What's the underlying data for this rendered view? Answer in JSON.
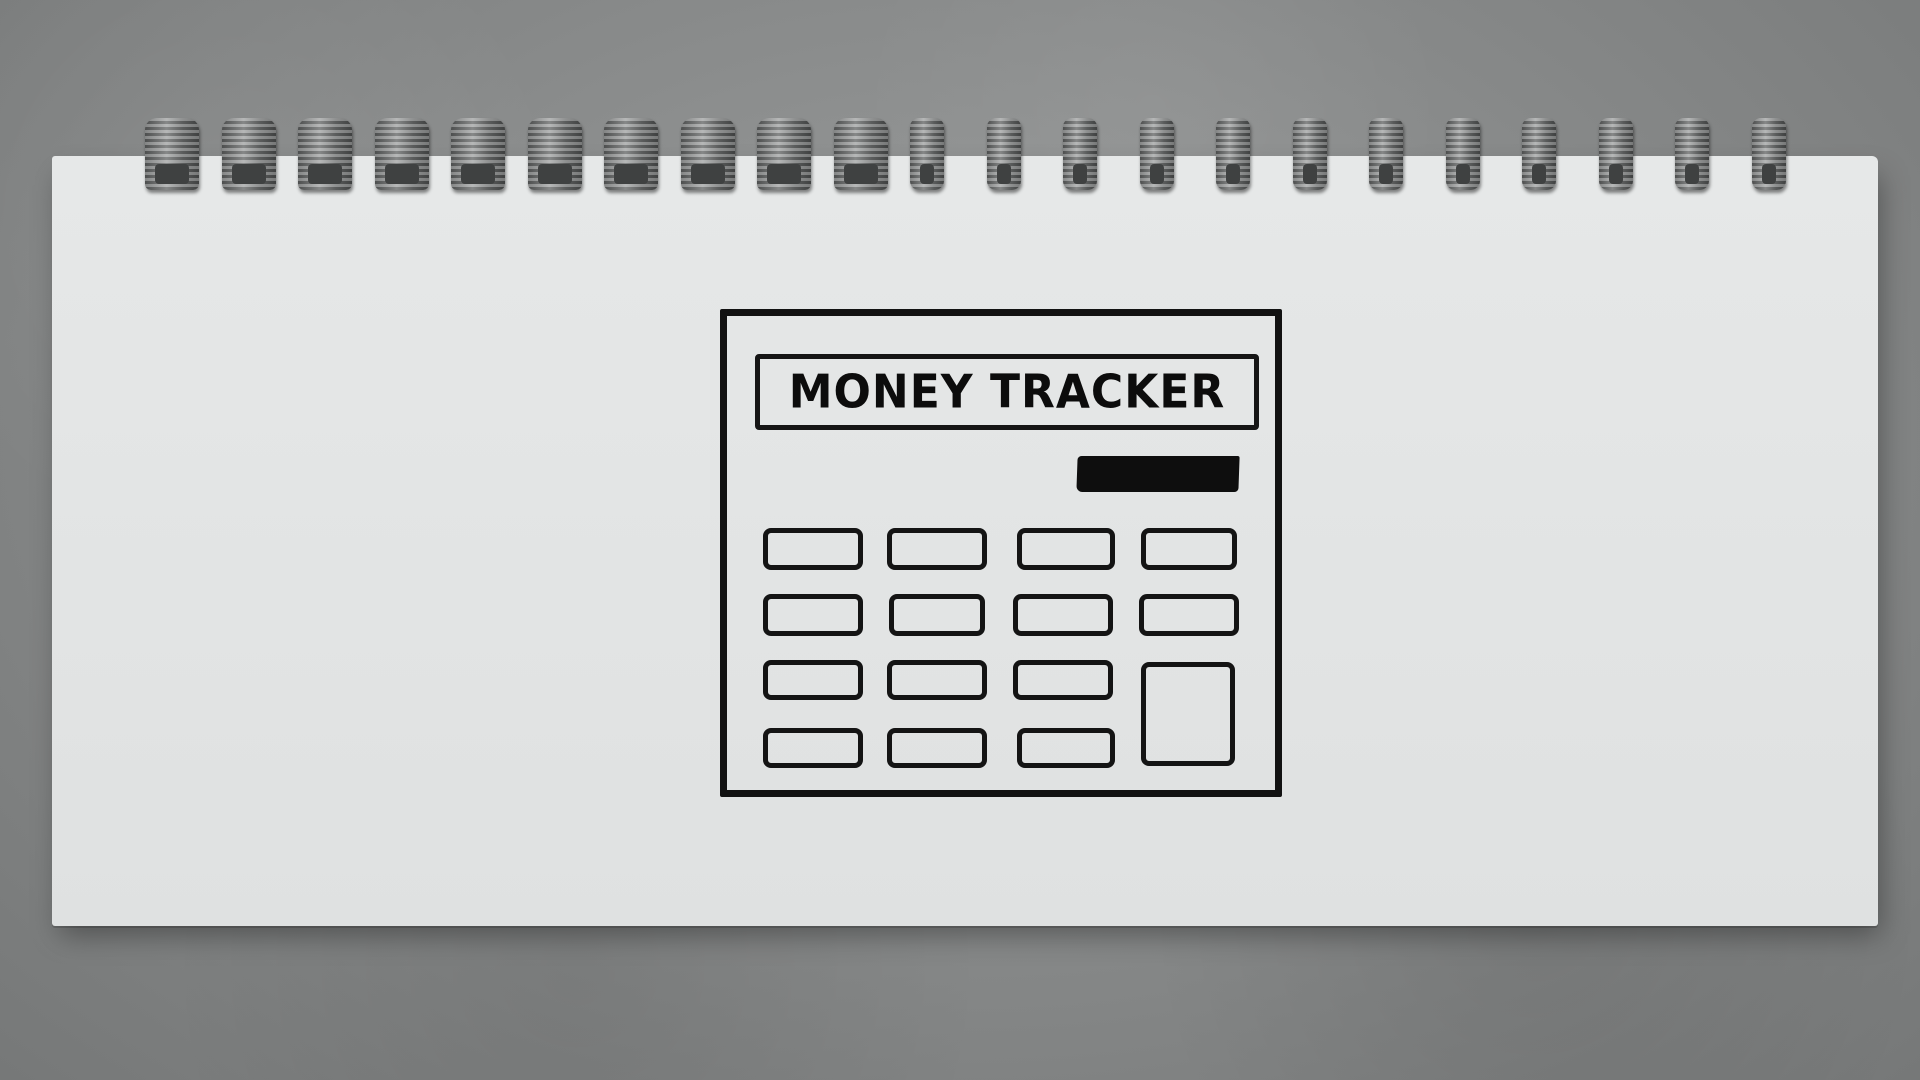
{
  "scene": {
    "description_icon": "notebook-icon",
    "ring_count": 22
  },
  "calculator": {
    "display_text": "MONEY TRACKER",
    "key_rows": 4,
    "key_columns": 4
  },
  "colors": {
    "paper": "#e3e5e5",
    "ink": "#121212",
    "surface": "#8a8c8c"
  }
}
